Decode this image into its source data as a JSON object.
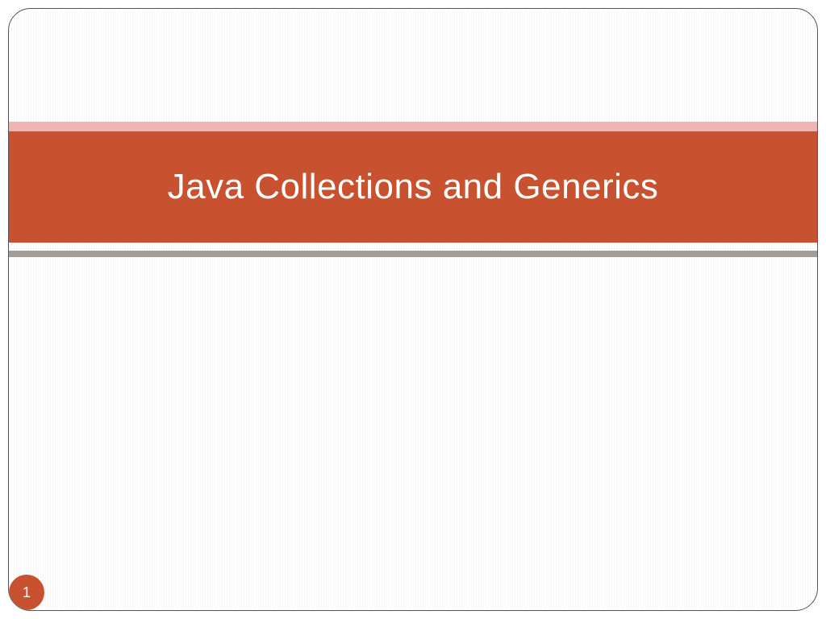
{
  "slide": {
    "title": "Java Collections and Generics",
    "page_number": "1"
  },
  "colors": {
    "accent": "#c8522f",
    "stripe_top": "#efb5b0",
    "stripe_bottom": "#a39c97"
  }
}
